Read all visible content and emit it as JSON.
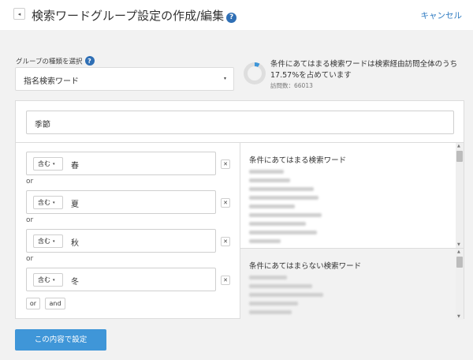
{
  "header": {
    "title": "検索ワードグループ設定の作成/編集",
    "help_icon": "?",
    "cancel_label": "キャンセル",
    "back_icon": "◂"
  },
  "group_type": {
    "label": "グループの種類を選択",
    "help_icon": "?",
    "selected": "指名検索ワード",
    "arrow": "▾"
  },
  "summary": {
    "text": "条件にあてはまる検索ワードは検索経由訪問全体のうち17.57%を占めています",
    "percent": 7.57,
    "visits": "訪問数：66013",
    "chart_color": "#3f96d8"
  },
  "group_name_value": "季節",
  "conditions": [
    {
      "operator": "含む",
      "value": "春"
    },
    {
      "operator": "含む",
      "value": "夏"
    },
    {
      "operator": "含む",
      "value": "秋"
    },
    {
      "operator": "含む",
      "value": "冬"
    }
  ],
  "connector_label": "or",
  "remove_icon": "✕",
  "op_caret": "▾",
  "logic_buttons": {
    "or": "or",
    "and": "and"
  },
  "matching_box": {
    "title": "条件にあてはまる検索ワード"
  },
  "non_matching_box": {
    "title": "条件にあてはまらない検索ワード"
  },
  "scroll_up": "▲",
  "scroll_down": "▼",
  "submit_label": "この内容で設定",
  "accent_color": "#3f96d8",
  "link_color": "#2f7bc1"
}
